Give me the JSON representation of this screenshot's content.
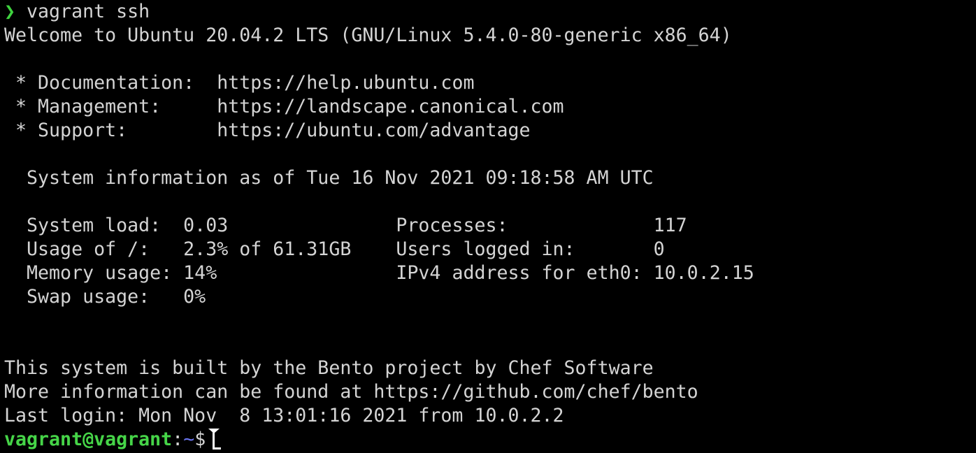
{
  "terminal": {
    "command_prompt_symbol": "❯",
    "command": " vagrant ssh",
    "welcome": "Welcome to Ubuntu 20.04.2 LTS (GNU/Linux 5.4.0-80-generic x86_64)",
    "links": [
      {
        "label": " * Documentation:  ",
        "url": "https://help.ubuntu.com"
      },
      {
        "label": " * Management:     ",
        "url": "https://landscape.canonical.com"
      },
      {
        "label": " * Support:        ",
        "url": "https://ubuntu.com/advantage"
      }
    ],
    "sysinfo_header": "  System information as of Tue 16 Nov 2021 09:18:58 AM UTC",
    "sysinfo_rows": [
      {
        "left": "  System load:  0.03               ",
        "right": "Processes:             117"
      },
      {
        "left": "  Usage of /:   2.3% of 61.31GB    ",
        "right": "Users logged in:       0"
      },
      {
        "left": "  Memory usage: 14%                ",
        "right": "IPv4 address for eth0: 10.0.2.15"
      },
      {
        "left": "  Swap usage:   0%",
        "right": ""
      }
    ],
    "bento_line1": "This system is built by the Bento project by Chef Software",
    "bento_line2": "More information can be found at https://github.com/chef/bento",
    "last_login": "Last login: Mon Nov  8 13:01:16 2021 from 10.0.2.2",
    "prompt_user_host": "vagrant@vagrant",
    "prompt_colon": ":",
    "prompt_path": "~",
    "prompt_dollar": "$",
    "colors": {
      "background": "#000000",
      "text": "#d4d4d4",
      "prompt_green": "#46d548",
      "path_blue": "#6a75f0"
    }
  }
}
